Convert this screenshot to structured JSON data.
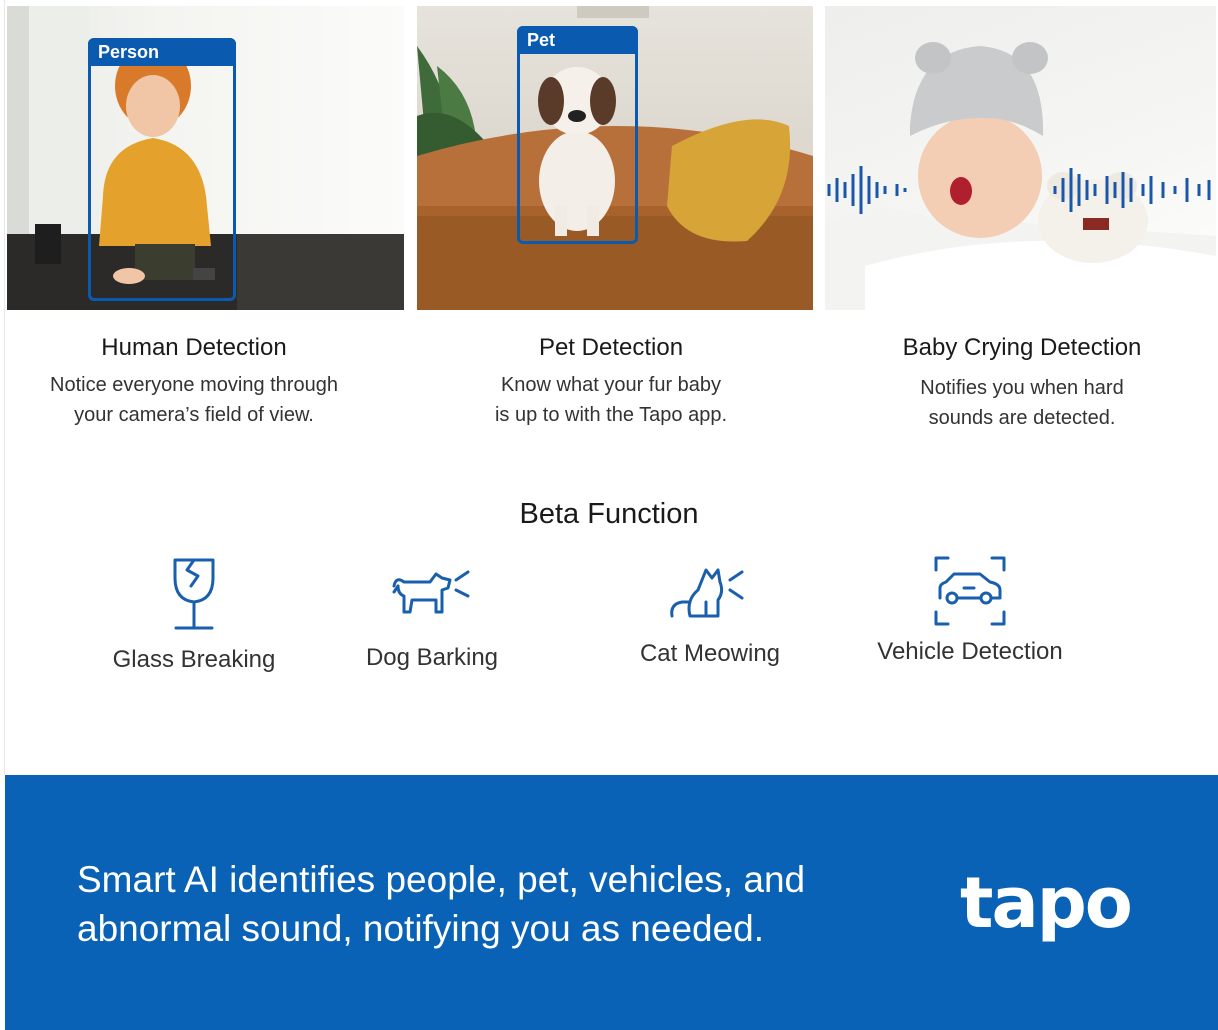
{
  "photos": {
    "human": {
      "tag": "Person"
    },
    "pet": {
      "tag": "Pet"
    },
    "baby": {}
  },
  "features": [
    {
      "title": "Human Detection",
      "desc_line1": "Notice everyone moving through",
      "desc_line2": "your camera’s field of view."
    },
    {
      "title": "Pet Detection",
      "desc_line1": "Know what your fur baby",
      "desc_line2": "is up to with the Tapo app."
    },
    {
      "title": "Baby Crying Detection",
      "desc_line1": "Notifies you when hard",
      "desc_line2": "sounds are detected."
    }
  ],
  "beta": {
    "title": "Beta Function",
    "items": [
      {
        "label": "Glass Breaking",
        "icon": "broken-glass-icon"
      },
      {
        "label": "Dog Barking",
        "icon": "dog-barking-icon"
      },
      {
        "label": "Cat Meowing",
        "icon": "cat-meowing-icon"
      },
      {
        "label": "Vehicle Detection",
        "icon": "vehicle-scan-icon"
      }
    ]
  },
  "banner": {
    "line1": "Smart AI identifies people, pet, vehicles, and",
    "line2": "abnormal sound, notifying you as needed.",
    "logo": "tapo"
  },
  "colors": {
    "brand_blue": "#0962b5",
    "box_blue": "#0a5bb0",
    "icon_blue": "#1a5fae"
  }
}
